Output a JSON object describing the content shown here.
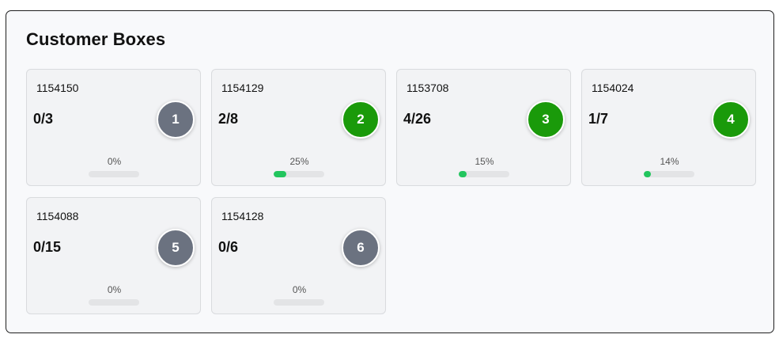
{
  "header": {
    "title": "Customer Boxes"
  },
  "colors": {
    "green": "#1a9a0a",
    "gray": "#6b7280",
    "progress": "#22c55e"
  },
  "boxes": [
    {
      "id": "1154150",
      "count": "0/3",
      "badge": "1",
      "status": "gray",
      "percent": "0%",
      "progress": 0
    },
    {
      "id": "1154129",
      "count": "2/8",
      "badge": "2",
      "status": "green",
      "percent": "25%",
      "progress": 0.25
    },
    {
      "id": "1153708",
      "count": "4/26",
      "badge": "3",
      "status": "green",
      "percent": "15%",
      "progress": 0.15
    },
    {
      "id": "1154024",
      "count": "1/7",
      "badge": "4",
      "status": "green",
      "percent": "14%",
      "progress": 0.14
    },
    {
      "id": "1154088",
      "count": "0/15",
      "badge": "5",
      "status": "gray",
      "percent": "0%",
      "progress": 0
    },
    {
      "id": "1154128",
      "count": "0/6",
      "badge": "6",
      "status": "gray",
      "percent": "0%",
      "progress": 0
    }
  ]
}
